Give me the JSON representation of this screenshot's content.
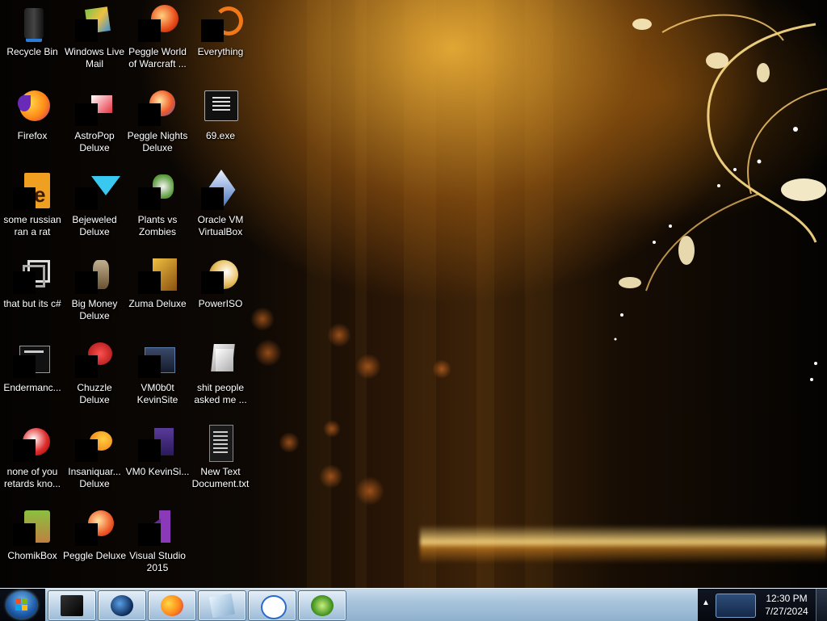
{
  "desktop": {
    "icons": [
      {
        "label": "Recycle Bin",
        "icon": "recycle-bin-icon"
      },
      {
        "label": "Windows Live Mail",
        "icon": "mail-icon"
      },
      {
        "label": "Peggle World of Warcraft ...",
        "icon": "peggle-icon"
      },
      {
        "label": "Everything",
        "icon": "search-app-icon"
      },
      {
        "label": "Firefox",
        "icon": "firefox-icon"
      },
      {
        "label": "AstroPop Deluxe",
        "icon": "game-icon"
      },
      {
        "label": "Peggle Nights Deluxe",
        "icon": "peggle-icon"
      },
      {
        "label": "69.exe",
        "icon": "executable-icon"
      },
      {
        "label": "some russian ran a rat",
        "icon": "file-icon"
      },
      {
        "label": "Bejeweled Deluxe",
        "icon": "gem-icon"
      },
      {
        "label": "Plants vs Zombies",
        "icon": "plant-icon"
      },
      {
        "label": "Oracle VM VirtualBox",
        "icon": "virtualbox-icon"
      },
      {
        "label": "that but its c#",
        "icon": "shortcut-icon"
      },
      {
        "label": "Big Money Deluxe",
        "icon": "game-icon"
      },
      {
        "label": "Zuma Deluxe",
        "icon": "game-icon"
      },
      {
        "label": "PowerISO",
        "icon": "disc-icon"
      },
      {
        "label": "Endermanc...",
        "icon": "executable-icon"
      },
      {
        "label": "Chuzzle Deluxe",
        "icon": "game-icon"
      },
      {
        "label": "VM0b0t KevinSite",
        "icon": "folder-icon"
      },
      {
        "label": "shit people asked me ...",
        "icon": "folder-icon"
      },
      {
        "label": "none of you retards kno...",
        "icon": "game-icon"
      },
      {
        "label": "Insaniquar... Deluxe",
        "icon": "fish-icon"
      },
      {
        "label": "VM0 KevinSi...",
        "icon": "document-icon"
      },
      {
        "label": "New Text Document.txt",
        "icon": "text-file-icon"
      },
      {
        "label": "ChomikBox",
        "icon": "chomikbox-icon"
      },
      {
        "label": "Peggle Deluxe",
        "icon": "peggle-icon"
      },
      {
        "label": "Visual Studio 2015",
        "icon": "visual-studio-icon"
      }
    ]
  },
  "taskbar": {
    "pinned": [
      {
        "name": "taskbar-app-1",
        "icon": "black-box-icon"
      },
      {
        "name": "taskbar-app-2",
        "icon": "globe-icon"
      },
      {
        "name": "taskbar-firefox",
        "icon": "firefox-icon"
      },
      {
        "name": "taskbar-app-4",
        "icon": "notepad-icon"
      },
      {
        "name": "taskbar-app-5",
        "icon": "a-letter-icon"
      },
      {
        "name": "taskbar-app-6",
        "icon": "green-app-icon"
      }
    ],
    "clock": {
      "time": "12:30 PM",
      "date": "7/27/2024"
    }
  },
  "colors": {
    "accent": "#ffb43c",
    "taskbar": "#a8c4dc"
  }
}
